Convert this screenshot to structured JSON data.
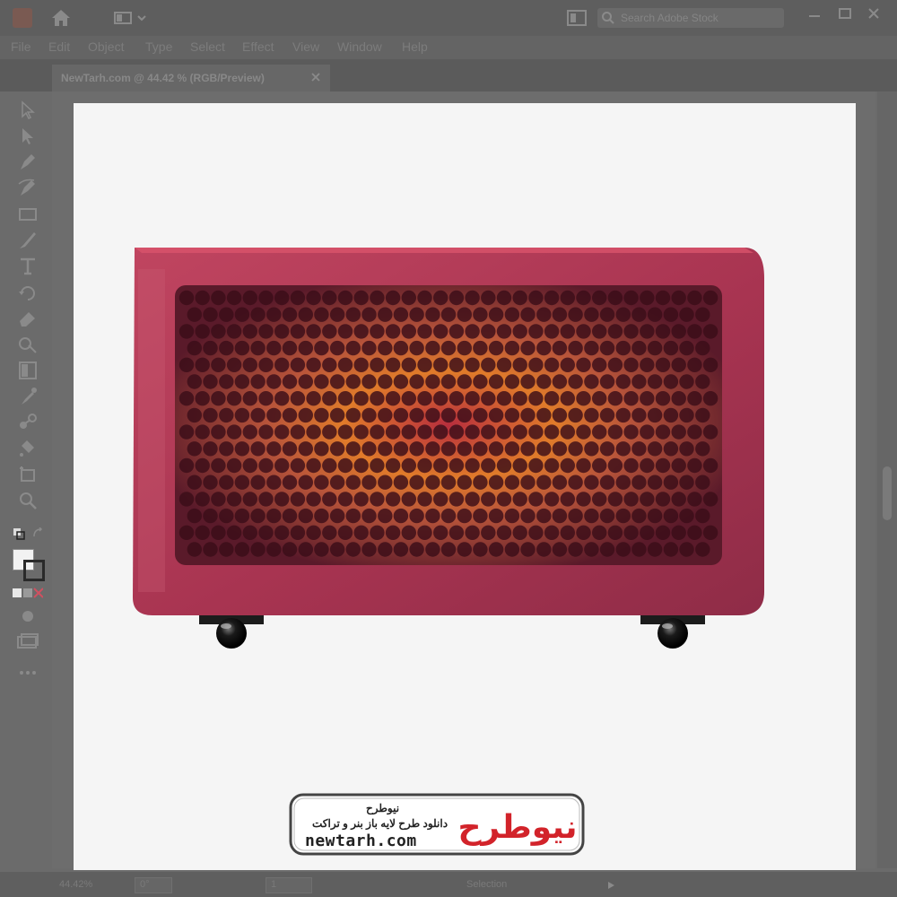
{
  "app": {
    "document_tab": "NewTarh.com @ 44.42 % (RGB/Preview)",
    "search_placeholder": "Search Adobe Stock"
  },
  "menu": [
    "File",
    "Edit",
    "Object",
    "Type",
    "Select",
    "Effect",
    "View",
    "Window",
    "Help"
  ],
  "tools": [
    "selection-tool-icon",
    "direct-selection-tool-icon",
    "pen-tool-icon",
    "curvature-tool-icon",
    "rectangle-tool-icon",
    "paintbrush-tool-icon",
    "type-tool-icon",
    "rotate-tool-icon",
    "eraser-tool-icon",
    "shape-builder-tool-icon",
    "gradient-tool-icon",
    "eyedropper-tool-icon",
    "blend-tool-icon",
    "symbol-sprayer-tool-icon",
    "artboard-tool-icon",
    "zoom-tool-icon"
  ],
  "status": {
    "zoom": "44.42%",
    "rotation": "0°",
    "artboard_number": "1",
    "tool": "Selection"
  },
  "watermark": {
    "line1": "نیوطرح",
    "line2": "دانلود طرح لایه باز بنر و تراکت",
    "line3": "newtarh.com",
    "logo_text": "نیوطرح"
  },
  "colors": {
    "heater_body": "#a8334f",
    "heater_edge": "#c44760",
    "grille_hole": "#3a0d18",
    "glow_center": "#e07b2a",
    "glow_core": "#b72e3d",
    "wheel": "#111111",
    "logo_red": "#d2232a",
    "logo_blue": "#1f5fa8"
  }
}
